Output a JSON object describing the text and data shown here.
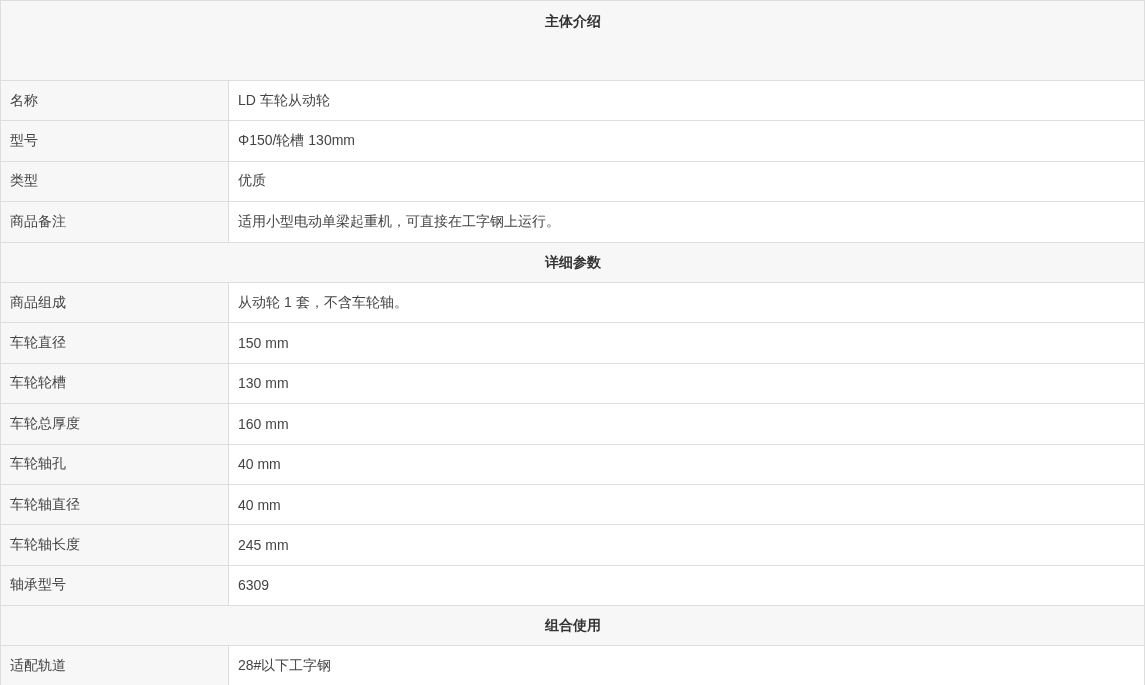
{
  "sections": [
    {
      "title": "主体介绍",
      "rows": [
        {
          "label": "名称",
          "value": "LD 车轮从动轮"
        },
        {
          "label": "型号",
          "value": "Φ150/轮槽 130mm"
        },
        {
          "label": "类型",
          "value": "优质"
        },
        {
          "label": "商品备注",
          "value": "适用小型电动单梁起重机，可直接在工字钢上运行。"
        }
      ]
    },
    {
      "title": "详细参数",
      "rows": [
        {
          "label": "商品组成",
          "value": "从动轮 1 套，不含车轮轴。"
        },
        {
          "label": "车轮直径",
          "value": "150 mm"
        },
        {
          "label": "车轮轮槽",
          "value": "130 mm"
        },
        {
          "label": "车轮总厚度",
          "value": "160 mm"
        },
        {
          "label": "车轮轴孔",
          "value": "40 mm"
        },
        {
          "label": "车轮轴直径",
          "value": "40 mm"
        },
        {
          "label": "车轮轴长度",
          "value": "245 mm"
        },
        {
          "label": "轴承型号",
          "value": "6309"
        }
      ]
    },
    {
      "title": "组合使用",
      "rows": [
        {
          "label": "适配轨道",
          "value": "28#以下工字钢"
        }
      ]
    }
  ]
}
